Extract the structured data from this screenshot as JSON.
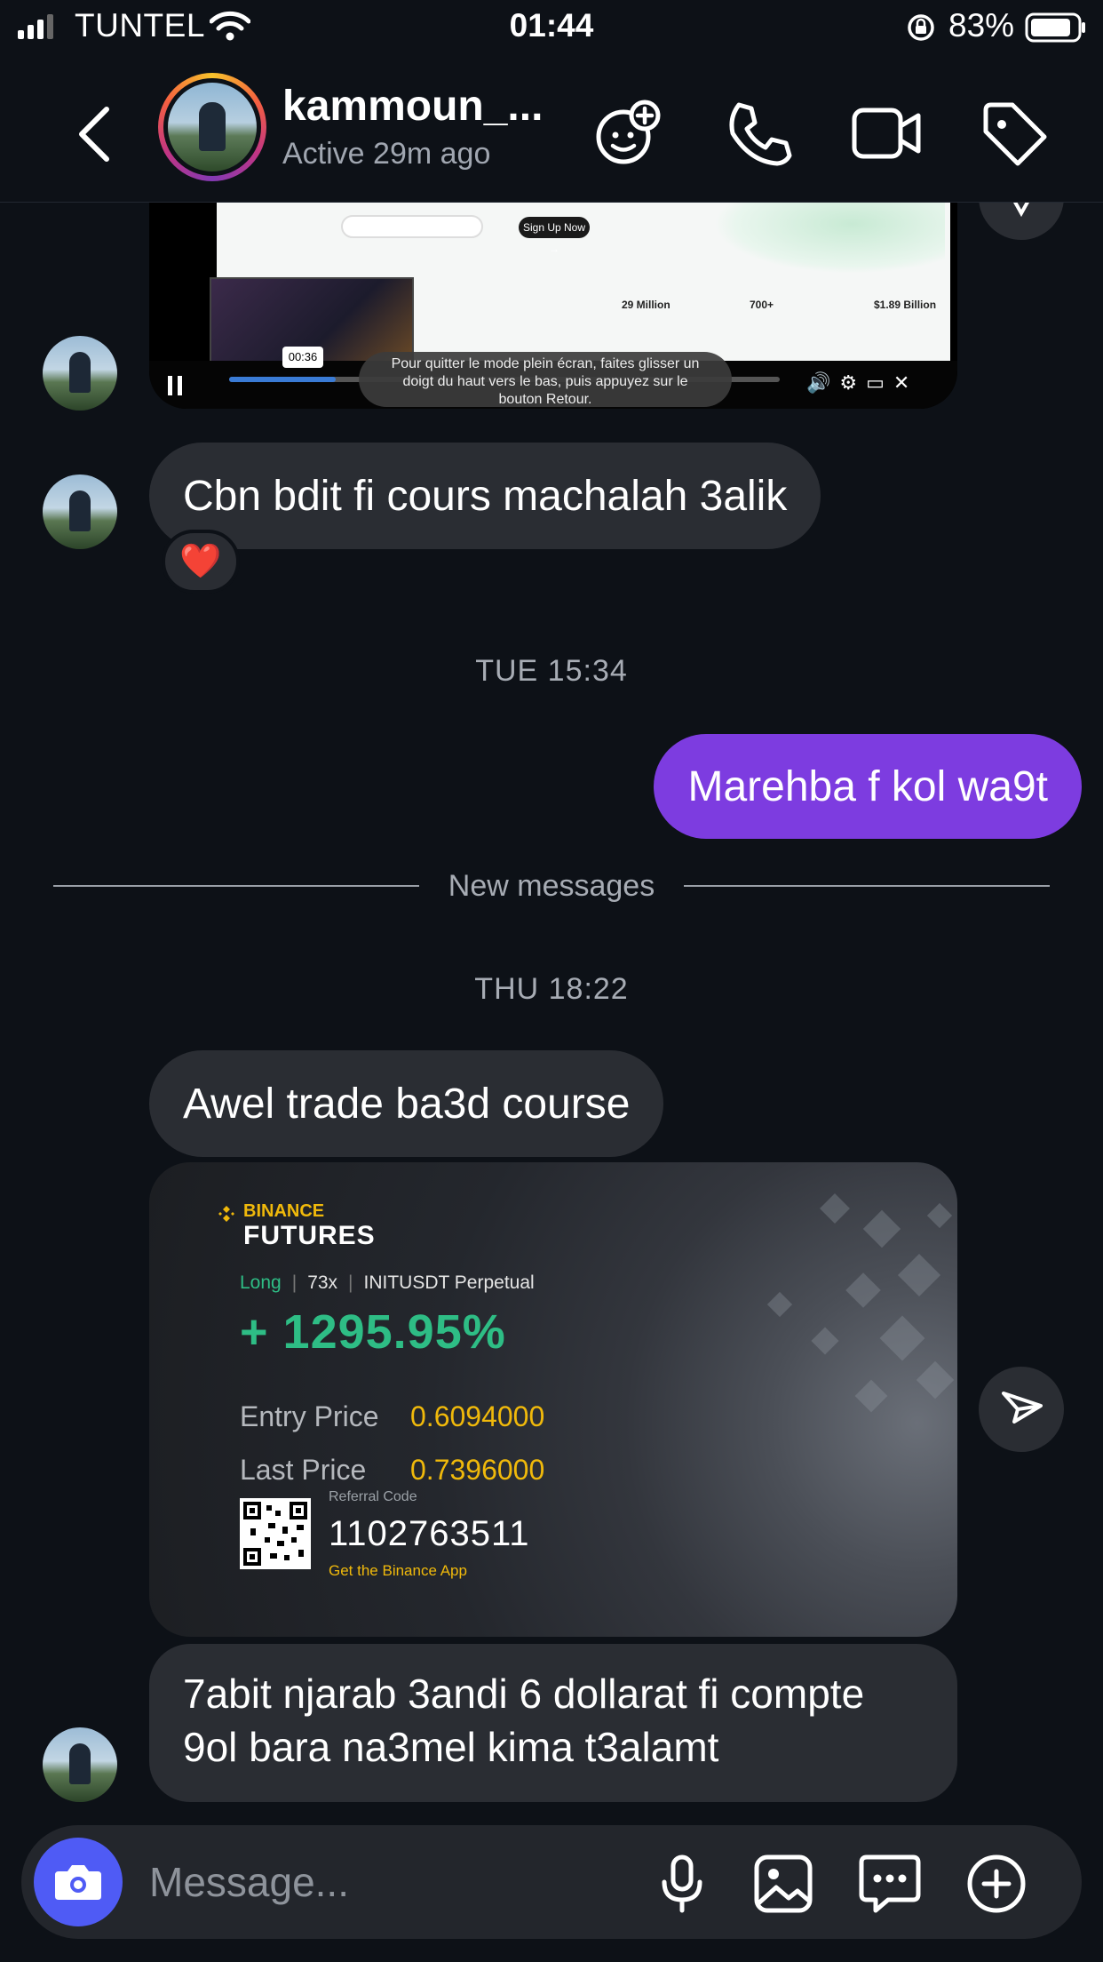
{
  "status_bar": {
    "carrier": "TUNTEL",
    "time": "01:44",
    "battery": "83%"
  },
  "header": {
    "username": "kammoun_...",
    "status": "Active 29m ago"
  },
  "video_message": {
    "time_badge": "00:36",
    "toast": "Pour quitter le mode plein écran, faites glisser un doigt du haut vers le bas, puis appuyez sur le bouton Retour.",
    "site_button": "Sign Up Now →",
    "stats": [
      "29 Million",
      "700+",
      "$1.89 Billion"
    ]
  },
  "messages": {
    "msg1": "Cbn bdit fi cours machalah 3alik",
    "msg1_reaction": "❤️",
    "timestamp1": "TUE 15:34",
    "msg2_out": "Marehba f kol wa9t",
    "divider": "New messages",
    "timestamp2": "THU 18:22",
    "msg3": "Awel trade ba3d course",
    "msg4_line1": "7abit njarab 3andi 6 dollarat fi compte",
    "msg4_line2": "9ol bara na3mel kima t3alamt"
  },
  "binance_card": {
    "brand": "BINANCE",
    "product": "FUTURES",
    "side": "Long",
    "leverage": "73x",
    "pair": "INITUSDT Perpetual",
    "pnl": "+ 1295.95%",
    "entry_label": "Entry Price",
    "entry_value": "0.6094000",
    "last_label": "Last Price",
    "last_value": "0.7396000",
    "referral_label": "Referral Code",
    "referral_code": "1102763511",
    "app_cta": "Get the Binance App"
  },
  "composer": {
    "placeholder": "Message..."
  },
  "colors": {
    "background": "#0d1117",
    "bubble_in": "#2a2d33",
    "bubble_out": "#7d3ce0",
    "camera_button": "#4f5bf5",
    "binance_yellow": "#f0b90b",
    "binance_green": "#2ebd85"
  },
  "icons": {
    "header": [
      "back-chevron-icon",
      "avatar-effect-icon",
      "phone-icon",
      "video-call-icon",
      "tag-icon"
    ],
    "composer": [
      "camera-icon",
      "microphone-icon",
      "gallery-icon",
      "chat-sticker-icon",
      "plus-icon"
    ],
    "share": "send-icon"
  }
}
